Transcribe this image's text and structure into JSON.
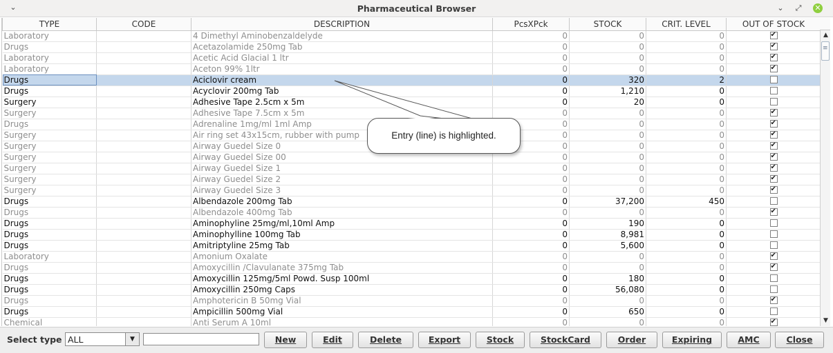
{
  "window": {
    "title": "Pharmaceutical Browser",
    "menu_icon": "chevron-down-icon",
    "minimize_icon": "minimize-icon",
    "maximize_icon": "restore-icon",
    "close_icon": "close-icon",
    "close_color": "#8fcf3f"
  },
  "table": {
    "columns": [
      "TYPE",
      "CODE",
      "DESCRIPTION",
      "PcsXPck",
      "STOCK",
      "CRIT. LEVEL",
      "OUT OF STOCK"
    ],
    "rows": [
      {
        "type": "Laboratory",
        "code": "",
        "description": "4 Dimethyl Aminobenzaldelyde",
        "pcs": "0",
        "stock": "0",
        "crit": "0",
        "out": true,
        "state": "dis"
      },
      {
        "type": "Drugs",
        "code": "",
        "description": "Acetazolamide 250mg Tab",
        "pcs": "0",
        "stock": "0",
        "crit": "0",
        "out": true,
        "state": "dis"
      },
      {
        "type": "Laboratory",
        "code": "",
        "description": "Acetic Acid Glacial 1 ltr",
        "pcs": "0",
        "stock": "0",
        "crit": "0",
        "out": true,
        "state": "dis"
      },
      {
        "type": "Laboratory",
        "code": "",
        "description": "Aceton 99% 1ltr",
        "pcs": "0",
        "stock": "0",
        "crit": "0",
        "out": true,
        "state": "dis"
      },
      {
        "type": "Drugs",
        "code": "",
        "description": "Aciclovir cream",
        "pcs": "0",
        "stock": "320",
        "crit": "2",
        "out": false,
        "state": "sel"
      },
      {
        "type": "Drugs",
        "code": "",
        "description": "Acyclovir 200mg Tab",
        "pcs": "0",
        "stock": "1,210",
        "crit": "0",
        "out": false,
        "state": "en"
      },
      {
        "type": "Surgery",
        "code": "",
        "description": "Adhesive Tape 2.5cm x 5m",
        "pcs": "0",
        "stock": "20",
        "crit": "0",
        "out": false,
        "state": "en"
      },
      {
        "type": "Surgery",
        "code": "",
        "description": "Adhesive Tape 7.5cm x 5m",
        "pcs": "0",
        "stock": "0",
        "crit": "0",
        "out": true,
        "state": "dis"
      },
      {
        "type": "Drugs",
        "code": "",
        "description": "Adrenaline 1mg/ml 1ml Amp",
        "pcs": "0",
        "stock": "0",
        "crit": "0",
        "out": true,
        "state": "dis"
      },
      {
        "type": "Surgery",
        "code": "",
        "description": "Air ring set 43x15cm, rubber with pump",
        "pcs": "0",
        "stock": "0",
        "crit": "0",
        "out": true,
        "state": "dis"
      },
      {
        "type": "Surgery",
        "code": "",
        "description": "Airway Guedel Size 0",
        "pcs": "0",
        "stock": "0",
        "crit": "0",
        "out": true,
        "state": "dis"
      },
      {
        "type": "Surgery",
        "code": "",
        "description": "Airway Guedel Size 00",
        "pcs": "0",
        "stock": "0",
        "crit": "0",
        "out": true,
        "state": "dis"
      },
      {
        "type": "Surgery",
        "code": "",
        "description": "Airway Guedel Size 1",
        "pcs": "0",
        "stock": "0",
        "crit": "0",
        "out": true,
        "state": "dis"
      },
      {
        "type": "Surgery",
        "code": "",
        "description": "Airway Guedel Size 2",
        "pcs": "0",
        "stock": "0",
        "crit": "0",
        "out": true,
        "state": "dis"
      },
      {
        "type": "Surgery",
        "code": "",
        "description": "Airway Guedel Size 3",
        "pcs": "0",
        "stock": "0",
        "crit": "0",
        "out": true,
        "state": "dis"
      },
      {
        "type": "Drugs",
        "code": "",
        "description": "Albendazole 200mg Tab",
        "pcs": "0",
        "stock": "37,200",
        "crit": "450",
        "out": false,
        "state": "en"
      },
      {
        "type": "Drugs",
        "code": "",
        "description": "Albendazole 400mg Tab",
        "pcs": "0",
        "stock": "0",
        "crit": "0",
        "out": true,
        "state": "dis"
      },
      {
        "type": "Drugs",
        "code": "",
        "description": "Aminophyline 25mg/ml,10ml Amp",
        "pcs": "0",
        "stock": "190",
        "crit": "0",
        "out": false,
        "state": "en"
      },
      {
        "type": "Drugs",
        "code": "",
        "description": "Aminophylline 100mg Tab",
        "pcs": "0",
        "stock": "8,981",
        "crit": "0",
        "out": false,
        "state": "en"
      },
      {
        "type": "Drugs",
        "code": "",
        "description": "Amitriptyline 25mg Tab",
        "pcs": "0",
        "stock": "5,600",
        "crit": "0",
        "out": false,
        "state": "en"
      },
      {
        "type": "Laboratory",
        "code": "",
        "description": "Amonium Oxalate",
        "pcs": "0",
        "stock": "0",
        "crit": "0",
        "out": true,
        "state": "dis"
      },
      {
        "type": "Drugs",
        "code": "",
        "description": "Amoxycillin /Clavulanate 375mg Tab",
        "pcs": "0",
        "stock": "0",
        "crit": "0",
        "out": true,
        "state": "dis"
      },
      {
        "type": "Drugs",
        "code": "",
        "description": "Amoxycillin 125mg/5ml Powd. Susp 100ml",
        "pcs": "0",
        "stock": "180",
        "crit": "0",
        "out": false,
        "state": "en"
      },
      {
        "type": "Drugs",
        "code": "",
        "description": "Amoxycillin 250mg Caps",
        "pcs": "0",
        "stock": "56,080",
        "crit": "0",
        "out": false,
        "state": "en"
      },
      {
        "type": "Drugs",
        "code": "",
        "description": "Amphotericin B 50mg Vial",
        "pcs": "0",
        "stock": "0",
        "crit": "0",
        "out": true,
        "state": "dis"
      },
      {
        "type": "Drugs",
        "code": "",
        "description": "Ampicillin 500mg Vial",
        "pcs": "0",
        "stock": "650",
        "crit": "0",
        "out": false,
        "state": "en"
      },
      {
        "type": "Chemical",
        "code": "",
        "description": "Anti Serum A 10ml",
        "pcs": "0",
        "stock": "0",
        "crit": "0",
        "out": true,
        "state": "dis"
      }
    ]
  },
  "callout": {
    "text": "Entry (line) is highlighted."
  },
  "scrollbar": {
    "up_icon": "arrow-up-icon",
    "down_icon": "arrow-down-icon"
  },
  "bottom": {
    "select_label": "Select type",
    "select_value": "ALL",
    "search_value": "",
    "buttons": [
      {
        "id": "new",
        "label": "New"
      },
      {
        "id": "edit",
        "label": "Edit"
      },
      {
        "id": "delete",
        "label": "Delete"
      },
      {
        "id": "export",
        "label": "Export"
      },
      {
        "id": "stock",
        "label": "Stock"
      },
      {
        "id": "stockcard",
        "label": "StockCard"
      },
      {
        "id": "order",
        "label": "Order"
      },
      {
        "id": "expiring",
        "label": "Expiring"
      },
      {
        "id": "amc",
        "label": "AMC"
      },
      {
        "id": "close",
        "label": "Close"
      }
    ]
  }
}
